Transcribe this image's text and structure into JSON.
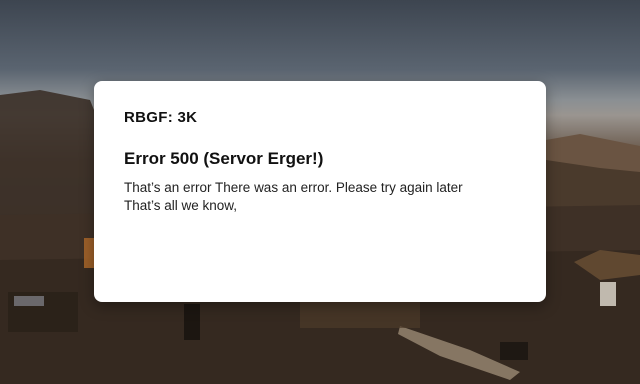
{
  "dialog": {
    "header": "RBGF: 3K",
    "title": "Error 500 (Servor Erger!)",
    "message_line1": "That’s an error There was an error. Please try again later",
    "message_line2": "That’s all we know,"
  },
  "colors": {
    "dialog_background": "#ffffff",
    "text": "#111111",
    "sky": "#4a535e",
    "ground": "#3a2c22"
  }
}
